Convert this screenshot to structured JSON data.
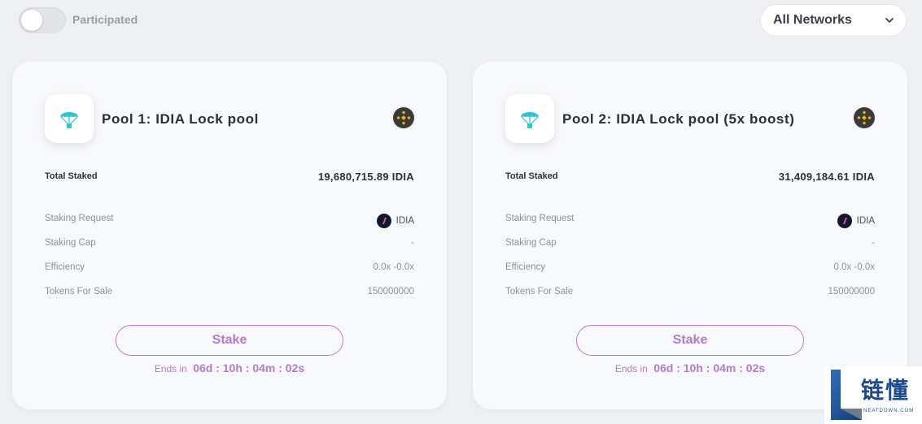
{
  "header": {
    "participated_label": "Participated",
    "participated_on": false,
    "network": "All Networks"
  },
  "pools": [
    {
      "title": "Pool 1: IDIA Lock pool",
      "total_staked_label": "Total Staked",
      "total_staked": "19,680,715.89 IDIA",
      "staking_request_label": "Staking Request",
      "staking_request": "IDIA",
      "staking_cap_label": "Staking Cap",
      "staking_cap": "-",
      "efficiency_label": "Efficiency",
      "efficiency": "0.0x -0.0x",
      "tokens_for_sale_label": "Tokens For Sale",
      "tokens_for_sale": "150000000",
      "stake_label": "Stake",
      "ends_label": "Ends in",
      "countdown": "06d : 10h : 04m : 02s",
      "chain_icon": "bnb-chain-icon"
    },
    {
      "title": "Pool 2: IDIA Lock pool (5x boost)",
      "total_staked_label": "Total Staked",
      "total_staked": "31,409,184.61 IDIA",
      "staking_request_label": "Staking Request",
      "staking_request": "IDIA",
      "staking_cap_label": "Staking Cap",
      "staking_cap": "-",
      "efficiency_label": "Efficiency",
      "efficiency": "0.0x -0.0x",
      "tokens_for_sale_label": "Tokens For Sale",
      "tokens_for_sale": "150000000",
      "stake_label": "Stake",
      "ends_label": "Ends in",
      "countdown": "06d : 10h : 04m : 02s",
      "chain_icon": "bnb-chain-icon"
    }
  ],
  "watermark": {
    "text": "链懂",
    "sub": "NEATDOWN.COM"
  },
  "colors": {
    "accent": "#b57ad0",
    "parachute": "#2bc4d3",
    "bnb": "#f0b90b"
  }
}
